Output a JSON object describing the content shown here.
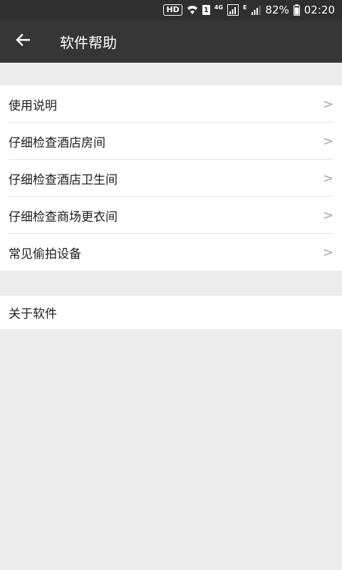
{
  "status_bar": {
    "hd_badge": "HD",
    "sim_badge": "1",
    "network_4g": "4G",
    "network_e": "E",
    "battery_percent": "82%",
    "time": "02:20"
  },
  "app_bar": {
    "title": "软件帮助"
  },
  "help_items": [
    {
      "label": "使用说明",
      "chevron": ">"
    },
    {
      "label": "仔细检查酒店房间",
      "chevron": ">"
    },
    {
      "label": "仔细检查酒店卫生间",
      "chevron": ">"
    },
    {
      "label": "仔细检查商场更衣间",
      "chevron": ">"
    },
    {
      "label": "常见偷拍设备",
      "chevron": ">"
    }
  ],
  "about": {
    "label": "关于软件"
  }
}
